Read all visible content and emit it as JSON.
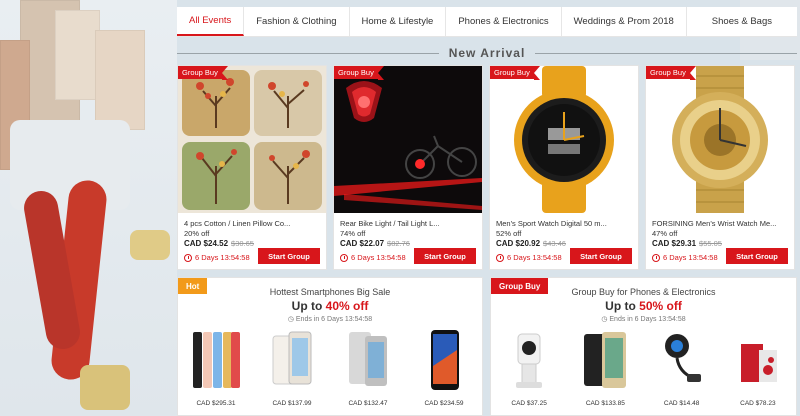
{
  "tabs": [
    {
      "label": "All Events",
      "active": true
    },
    {
      "label": "Fashion & Clothing",
      "active": false
    },
    {
      "label": "Home & Lifestyle",
      "active": false
    },
    {
      "label": "Phones & Electronics",
      "active": false
    },
    {
      "label": "Weddings & Prom 2018",
      "active": false
    },
    {
      "label": "Shoes & Bags",
      "active": false
    }
  ],
  "section_title": "New Arrival",
  "products": [
    {
      "badge": "Group Buy",
      "name": "4 pcs Cotton / Linen Pillow Co...",
      "discount": "20% off",
      "price": "CAD $24.52",
      "original_price": "$30.65",
      "timer": "6 Days 13:54:58",
      "button": "Start Group",
      "image": "pillow-covers"
    },
    {
      "badge": "Group Buy",
      "name": "Rear Bike Light / Tail Light L...",
      "discount": "74% off",
      "price": "CAD $22.07",
      "original_price": "$82.76",
      "timer": "6 Days 13:54:58",
      "button": "Start Group",
      "image": "bike-light"
    },
    {
      "badge": "Group Buy",
      "name": "Men's Sport Watch Digital 50 m...",
      "discount": "52% off",
      "price": "CAD $20.92",
      "original_price": "$43.46",
      "timer": "6 Days 13:54:58",
      "button": "Start Group",
      "image": "sport-watch"
    },
    {
      "badge": "Group Buy",
      "name": "FORSINING Men's Wrist Watch Me...",
      "discount": "47% off",
      "price": "CAD $29.31",
      "original_price": "$55.05",
      "timer": "6 Days 13:54:58",
      "button": "Start Group",
      "image": "gold-watch"
    }
  ],
  "promo_left": {
    "badge": "Hot",
    "badge_color": "#f29a1a",
    "title": "Hottest Smartphones Big Sale",
    "headline_prefix": "Up to ",
    "headline_highlight": "40% off",
    "ends": "Ends in 6 Days 13:54:58",
    "items": [
      {
        "price": "CAD $295.31",
        "image": "phone-colors"
      },
      {
        "price": "CAD $137.99",
        "image": "phone-white"
      },
      {
        "price": "CAD $132.47",
        "image": "phone-silver"
      },
      {
        "price": "CAD $234.59",
        "image": "phone-black"
      }
    ]
  },
  "promo_right": {
    "badge": "Group Buy",
    "badge_color": "#d8161b",
    "title": "Group Buy for Phones & Electronics",
    "headline_prefix": "Up to ",
    "headline_highlight": "50% off",
    "ends": "Ends in 6 Days 13:54:58",
    "items": [
      {
        "price": "CAD $37.25",
        "image": "security-camera"
      },
      {
        "price": "CAD $133.85",
        "image": "phone-gold"
      },
      {
        "price": "CAD $14.48",
        "image": "car-charger"
      },
      {
        "price": "CAD $78.23",
        "image": "gift-box"
      }
    ]
  },
  "colors": {
    "accent": "#d8161b",
    "hot": "#f29a1a"
  }
}
